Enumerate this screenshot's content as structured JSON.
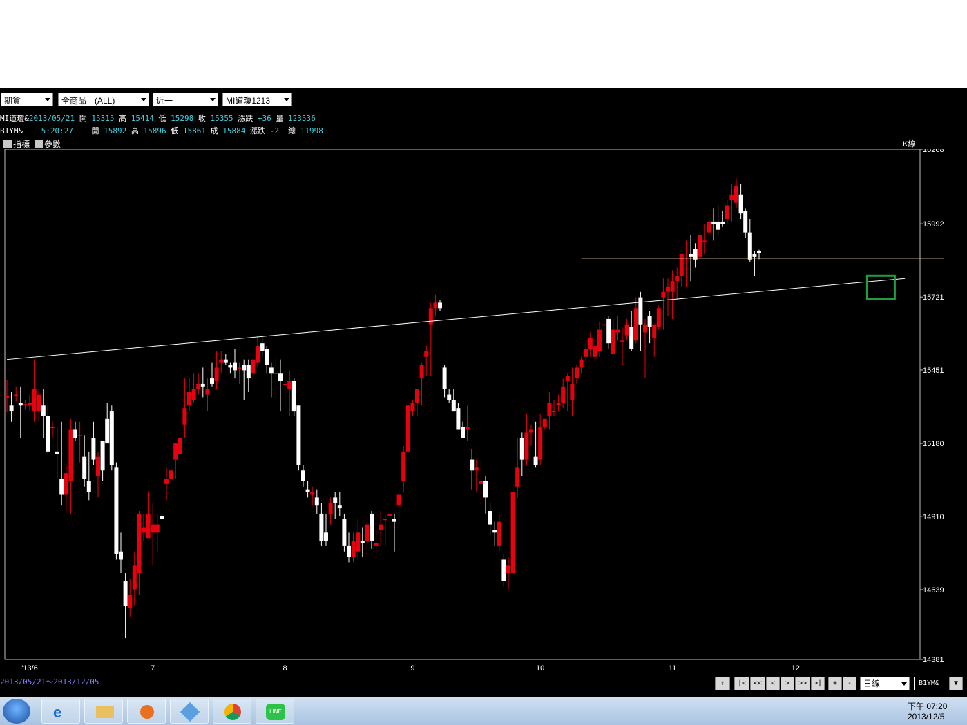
{
  "toolbar": {
    "dropdowns": [
      {
        "value": "期貨"
      },
      {
        "value": "全商品　(ALL)"
      },
      {
        "value": "近一"
      },
      {
        "value": "MI道瓊1213"
      }
    ],
    "indicator_label": "指標",
    "params_label": "參數",
    "kline_label": "K線"
  },
  "info_row1": {
    "symbol": "MI道瓊&",
    "date": "2013/05/21",
    "open_label": "開",
    "open": "15315",
    "high_label": "高",
    "high": "15414",
    "low_label": "低",
    "low": "15298",
    "close_label": "收",
    "close": "15355",
    "change_label": "漲跌",
    "change": "+36",
    "vol_label": "量",
    "vol": "123536"
  },
  "info_row2": {
    "symbol": "B1YM&",
    "time": "5:20:27",
    "open_label": "開",
    "open": "15892",
    "high_label": "高",
    "high": "15896",
    "low_label": "低",
    "low": "15861",
    "close_label": "成",
    "close": "15884",
    "change_label": "漲跌",
    "change": "-2",
    "vol_label": "總",
    "vol": "11998"
  },
  "range_text": "2013/05/21～2013/12/05",
  "nav": {
    "up": "↑",
    "first": "|<",
    "fastback": "<<",
    "back": "<",
    "fwd": ">",
    "fastfwd": ">>",
    "last": ">|",
    "plus": "+",
    "minus": "-",
    "period": "日線",
    "symbol": "B1YM&",
    "down": "▼"
  },
  "taskbar": {
    "time": "下午 07:20",
    "date": "2013/12/5"
  },
  "colors": {
    "up": "#e8000f",
    "down": "#ffffff",
    "axis_text": "#ffffff",
    "trendline": "#ffffff",
    "hline": "#f0d090",
    "highlight_box": "#1e9e3e"
  },
  "chart_data": {
    "type": "candlestick",
    "ylim": [
      14381,
      16268
    ],
    "y_ticks": [
      16268,
      15992,
      15721,
      15451,
      15180,
      14910,
      14639,
      14381
    ],
    "x_labels": [
      "'13/6",
      "7",
      "8",
      "9",
      "10",
      "11",
      "12"
    ],
    "x_label_index": [
      5,
      32,
      61,
      89,
      117,
      146,
      173
    ],
    "candles": [
      [
        15348,
        15414,
        15298,
        15355
      ],
      [
        15320,
        15370,
        15260,
        15300
      ],
      [
        15355,
        15390,
        15335,
        15360
      ],
      [
        15330,
        15390,
        15200,
        15320
      ],
      [
        15320,
        15340,
        15305,
        15325
      ],
      [
        15320,
        15360,
        15300,
        15330
      ],
      [
        15300,
        15490,
        15260,
        15380
      ],
      [
        15300,
        15380,
        15260,
        15360
      ],
      [
        15320,
        15380,
        15200,
        15280
      ],
      [
        15280,
        15320,
        15140,
        15150
      ],
      [
        15240,
        15260,
        15200,
        15240
      ],
      [
        15150,
        15240,
        15050,
        15140
      ],
      [
        15050,
        15260,
        14950,
        14990
      ],
      [
        14990,
        15100,
        14930,
        15070
      ],
      [
        15040,
        15270,
        14920,
        15230
      ],
      [
        15230,
        15260,
        15190,
        15200
      ],
      [
        15210,
        15260,
        15110,
        15210
      ],
      [
        15130,
        15210,
        15020,
        15050
      ],
      [
        15040,
        15150,
        14970,
        15000
      ],
      [
        15200,
        15260,
        15100,
        15120
      ],
      [
        15060,
        15150,
        14980,
        15130
      ],
      [
        15190,
        15150,
        15040,
        15080
      ],
      [
        15270,
        15330,
        15190,
        15180
      ],
      [
        15300,
        15320,
        15080,
        15100
      ],
      [
        15090,
        15110,
        14750,
        14770
      ],
      [
        14780,
        14850,
        14700,
        14750
      ],
      [
        14670,
        14700,
        14460,
        14580
      ],
      [
        14570,
        14680,
        14540,
        14620
      ],
      [
        14640,
        14780,
        14580,
        14730
      ],
      [
        14700,
        14930,
        14620,
        14920
      ],
      [
        14850,
        14920,
        14820,
        14870
      ],
      [
        14830,
        15000,
        14830,
        14920
      ],
      [
        14850,
        14960,
        14730,
        14880
      ],
      [
        14850,
        14920,
        14780,
        14880
      ],
      [
        14910,
        14920,
        14910,
        14900
      ],
      [
        15030,
        15090,
        14970,
        15050
      ],
      [
        15050,
        15100,
        15050,
        15080
      ],
      [
        15120,
        15170,
        15050,
        15180
      ],
      [
        15140,
        15200,
        15150,
        15200
      ],
      [
        15250,
        15420,
        15200,
        15310
      ],
      [
        15320,
        15420,
        15300,
        15370
      ],
      [
        15340,
        15440,
        15330,
        15380
      ],
      [
        15380,
        15440,
        15360,
        15400
      ],
      [
        15400,
        15460,
        15350,
        15390
      ],
      [
        15360,
        15420,
        15300,
        15380
      ],
      [
        15420,
        15480,
        15390,
        15400
      ],
      [
        15410,
        15520,
        15380,
        15460
      ],
      [
        15480,
        15520,
        15440,
        15490
      ],
      [
        15490,
        15510,
        15470,
        15480
      ],
      [
        15470,
        15480,
        15440,
        15460
      ],
      [
        15480,
        15530,
        15420,
        15450
      ],
      [
        15460,
        15480,
        15400,
        15460
      ],
      [
        15470,
        15490,
        15340,
        15450
      ],
      [
        15470,
        15490,
        15370,
        15420
      ],
      [
        15440,
        15520,
        15410,
        15490
      ],
      [
        15480,
        15580,
        15460,
        15540
      ],
      [
        15550,
        15580,
        15500,
        15520
      ],
      [
        15530,
        15540,
        15440,
        15470
      ],
      [
        15460,
        15480,
        15350,
        15440
      ],
      [
        15440,
        15500,
        15340,
        15440
      ],
      [
        15440,
        15490,
        15300,
        15410
      ],
      [
        15400,
        15450,
        15320,
        15400
      ],
      [
        15380,
        15450,
        15280,
        15410
      ],
      [
        15410,
        15420,
        15280,
        15300
      ],
      [
        15320,
        15320,
        15080,
        15100
      ],
      [
        15080,
        15100,
        15020,
        15040
      ],
      [
        15010,
        15040,
        14980,
        15000
      ],
      [
        14990,
        15020,
        14950,
        15000
      ],
      [
        14980,
        15010,
        14920,
        14950
      ],
      [
        14920,
        14960,
        14800,
        14820
      ],
      [
        14850,
        14920,
        14800,
        14820
      ],
      [
        14920,
        14980,
        14880,
        14960
      ],
      [
        14980,
        15000,
        14900,
        14960
      ],
      [
        14950,
        15000,
        14910,
        14940
      ],
      [
        14900,
        14920,
        14780,
        14800
      ],
      [
        14800,
        14850,
        14740,
        14760
      ],
      [
        14760,
        14850,
        14740,
        14820
      ],
      [
        14780,
        14900,
        14750,
        14850
      ],
      [
        14820,
        14870,
        14760,
        14810
      ],
      [
        14820,
        14910,
        14760,
        14880
      ],
      [
        14920,
        14930,
        14790,
        14820
      ],
      [
        14800,
        14860,
        14760,
        14810
      ],
      [
        14860,
        14930,
        14800,
        14880
      ],
      [
        14900,
        14920,
        14800,
        14900
      ],
      [
        14910,
        14930,
        14880,
        14920
      ],
      [
        14900,
        14920,
        14780,
        14890
      ],
      [
        14950,
        15010,
        14880,
        14990
      ],
      [
        15040,
        15170,
        15000,
        15150
      ],
      [
        15150,
        15290,
        15140,
        15320
      ],
      [
        15300,
        15340,
        15280,
        15330
      ],
      [
        15330,
        15330,
        15280,
        15380
      ],
      [
        15420,
        15480,
        15320,
        15470
      ],
      [
        15500,
        15540,
        15430,
        15520
      ],
      [
        15620,
        15700,
        15430,
        15680
      ],
      [
        15680,
        15730,
        15650,
        15700
      ],
      [
        15700,
        15710,
        15670,
        15680
      ],
      [
        15460,
        15470,
        15350,
        15380
      ],
      [
        15360,
        15380,
        15330,
        15340
      ],
      [
        15340,
        15380,
        15300,
        15300
      ],
      [
        15310,
        15330,
        15230,
        15230
      ],
      [
        15240,
        15260,
        15200,
        15200
      ],
      [
        15230,
        15320,
        15190,
        15240
      ],
      [
        15120,
        15160,
        15010,
        15080
      ],
      [
        15080,
        15120,
        15000,
        15090
      ],
      [
        15030,
        15120,
        14950,
        15040
      ],
      [
        15040,
        15060,
        14920,
        14980
      ],
      [
        14930,
        14960,
        14840,
        14880
      ],
      [
        14860,
        14890,
        14800,
        14850
      ],
      [
        14800,
        14920,
        14780,
        14890
      ],
      [
        14750,
        14770,
        14650,
        14670
      ],
      [
        14700,
        14760,
        14640,
        14730
      ],
      [
        14700,
        15030,
        14700,
        15000
      ],
      [
        15020,
        15200,
        14980,
        15090
      ],
      [
        15200,
        15220,
        15060,
        15120
      ],
      [
        15120,
        15290,
        15100,
        15220
      ],
      [
        15220,
        15250,
        15170,
        15230
      ],
      [
        15130,
        15260,
        15090,
        15100
      ],
      [
        15120,
        15290,
        15100,
        15240
      ],
      [
        15240,
        15270,
        15230,
        15270
      ],
      [
        15280,
        15370,
        15230,
        15330
      ],
      [
        15300,
        15340,
        15280,
        15300
      ],
      [
        15320,
        15360,
        15300,
        15330
      ],
      [
        15330,
        15420,
        15310,
        15390
      ],
      [
        15410,
        15440,
        15300,
        15430
      ],
      [
        15340,
        15460,
        15280,
        15400
      ],
      [
        15420,
        15470,
        15400,
        15460
      ],
      [
        15460,
        15500,
        15440,
        15490
      ],
      [
        15500,
        15550,
        15480,
        15530
      ],
      [
        15530,
        15590,
        15500,
        15570
      ],
      [
        15500,
        15570,
        15470,
        15540
      ],
      [
        15520,
        15630,
        15500,
        15600
      ],
      [
        15620,
        15650,
        15580,
        15620
      ],
      [
        15640,
        15650,
        15530,
        15550
      ],
      [
        15510,
        15640,
        15510,
        15600
      ],
      [
        15590,
        15650,
        15560,
        15600
      ],
      [
        15560,
        15610,
        15470,
        15560
      ],
      [
        15580,
        15640,
        15560,
        15620
      ],
      [
        15610,
        15670,
        15520,
        15530
      ],
      [
        15560,
        15720,
        15550,
        15680
      ],
      [
        15720,
        15740,
        15520,
        15620
      ],
      [
        15590,
        15640,
        15420,
        15620
      ],
      [
        15650,
        15670,
        15550,
        15610
      ],
      [
        15570,
        15620,
        15500,
        15620
      ],
      [
        15610,
        15690,
        15600,
        15680
      ],
      [
        15720,
        15790,
        15600,
        15740
      ],
      [
        15740,
        15790,
        15650,
        15760
      ],
      [
        15740,
        15820,
        15640,
        15780
      ],
      [
        15780,
        15830,
        15710,
        15800
      ],
      [
        15800,
        15880,
        15760,
        15880
      ],
      [
        15860,
        15930,
        15760,
        15860
      ],
      [
        15880,
        15950,
        15780,
        15870
      ],
      [
        15900,
        15920,
        15830,
        15860
      ],
      [
        15870,
        15960,
        15880,
        15950
      ],
      [
        15930,
        15990,
        15880,
        15930
      ],
      [
        15960,
        16010,
        15930,
        16000
      ],
      [
        16000,
        16050,
        15930,
        15990
      ],
      [
        16000,
        16060,
        15950,
        15970
      ],
      [
        16000,
        16040,
        15980,
        15990
      ],
      [
        16010,
        16080,
        15990,
        16060
      ],
      [
        16080,
        16140,
        16000,
        16100
      ],
      [
        16070,
        16160,
        16050,
        16130
      ],
      [
        16100,
        16140,
        16010,
        16030
      ],
      [
        16040,
        16050,
        15940,
        15960
      ],
      [
        15960,
        16010,
        15850,
        15860
      ],
      [
        15880,
        15890,
        15800,
        15870
      ],
      [
        15892,
        15896,
        15861,
        15884
      ]
    ],
    "trendline": [
      [
        0,
        15490
      ],
      [
        197,
        15790
      ]
    ],
    "horizontal_line": 15865
  }
}
